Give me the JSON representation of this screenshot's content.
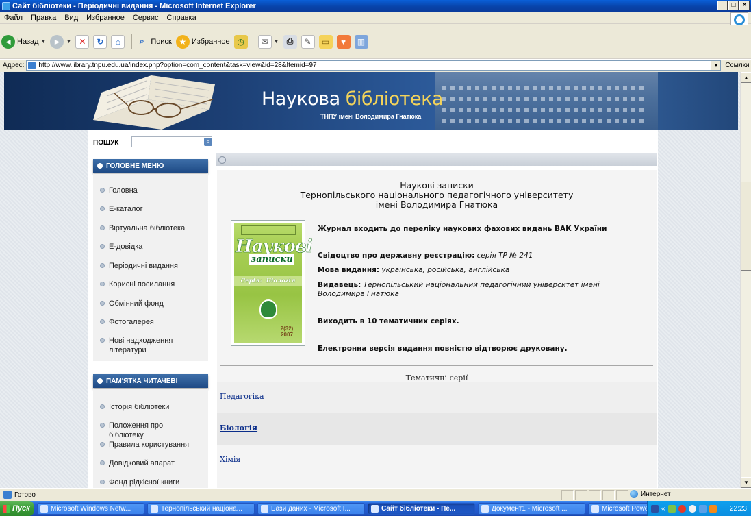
{
  "window": {
    "title": "Сайт бібліотеки - Періодичні видання - Microsoft Internet Explorer",
    "buttons": [
      "_",
      "□",
      "×"
    ]
  },
  "menu": [
    "Файл",
    "Правка",
    "Вид",
    "Избранное",
    "Сервис",
    "Справка"
  ],
  "toolbar": {
    "back": "Назад",
    "search": "Поиск",
    "favorites": "Избранное"
  },
  "address": {
    "label": "Адрес:",
    "url": "http://www.library.tnpu.edu.ua/index.php?option=com_content&task=view&id=28&Itemid=97",
    "links": "Ссылки"
  },
  "header": {
    "brand_main": "Наукова ",
    "brand_accent": "бібліотека",
    "subtitle": "ТНПУ імені Володимира Гнатюка"
  },
  "search": {
    "label": "ПОШУК",
    "placeholder": ""
  },
  "main_menu": {
    "title": "ГОЛОВНЕ МЕНЮ",
    "items": [
      "Головна",
      "Е-каталог",
      "Віртуальна бібліотека",
      "Е-довідка",
      "Періодичні видання",
      "Корисні посилання",
      "Обмінний фонд",
      "Фотогалерея",
      "Нові надходження літератури"
    ]
  },
  "reader_menu": {
    "title": "ПАМ'ЯТКА ЧИТАЧЕВІ",
    "items": [
      "Історія бібліотеки",
      "Положення про бібліотеку",
      "Правила користування",
      "Довідковий апарат",
      "Фонд рідкісної книги"
    ]
  },
  "article": {
    "title_lines": [
      "Наукові записки",
      "Тернопільського національного педагогічного університету",
      "імені Володимира Гнатюка"
    ],
    "vak": "Журнал входить до переліку наукових фахових видань ВАК України",
    "cert_label": "Свідоцтво про державну реєстрацію:",
    "cert_value": "серія ТР № 241",
    "lang_label": "Мова видання:",
    "lang_value": "українська, російська, англійська",
    "publisher_label": "Видавець:",
    "publisher_value": "Тернопільський національний педагогічний університет імені Володимира Гнатюка",
    "series_count": "Виходить в 10 тематичних серіях.",
    "electronic": "Електронна версія видання повністю відтворює друковану.",
    "series_caption": "Тематичні серії",
    "series": [
      "Педагогіка",
      "Біологія",
      "Хімія"
    ]
  },
  "cover": {
    "title": "Наукові",
    "subtitle": "записки",
    "band_left": "Серія:",
    "band_right": "Біологія",
    "issue": "2(32)",
    "year": "2007"
  },
  "status": {
    "text": "Готово",
    "zone": "Интернет"
  },
  "taskbar": {
    "start": "Пуск",
    "tasks": [
      "Microsoft Windows Netw...",
      "Тернопільський націона...",
      "Бази даних - Microsoft I...",
      "Сайт бібліотеки - Пе...",
      "Документ1 - Microsoft ...",
      "Microsoft PowerPoint - [..."
    ],
    "active_index": 3,
    "clock": "22:23"
  }
}
